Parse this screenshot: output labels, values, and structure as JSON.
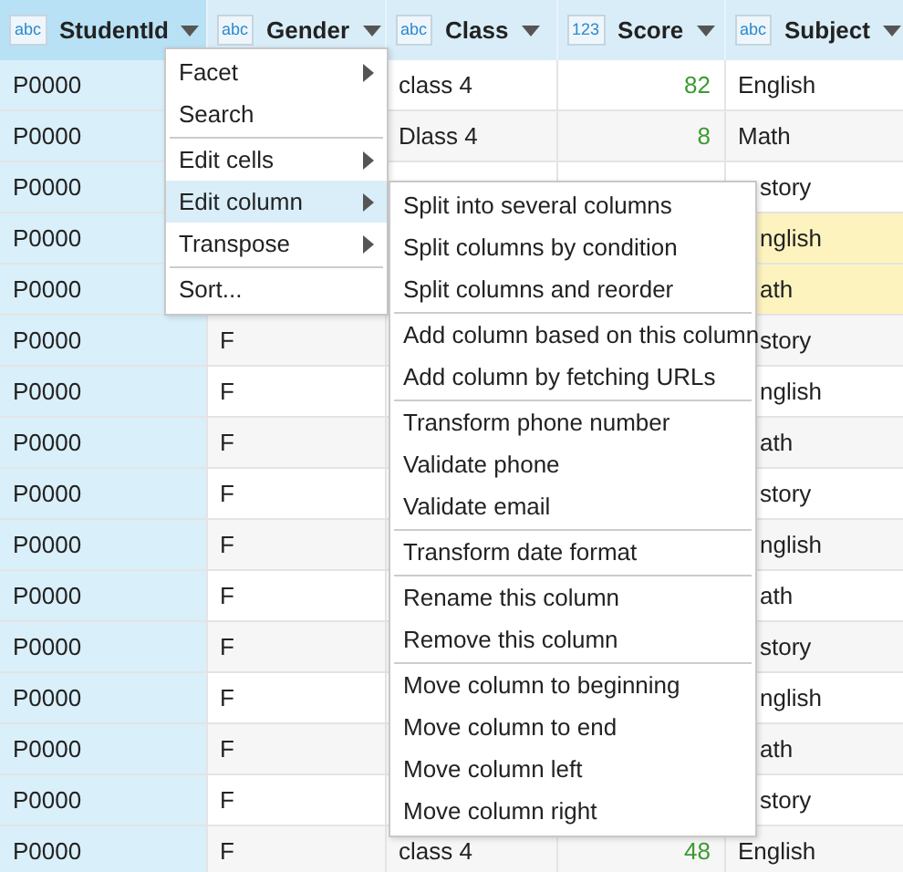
{
  "table": {
    "columns": [
      {
        "kind": "text",
        "type_label": "abc",
        "title": "StudentId",
        "selected": true
      },
      {
        "kind": "text",
        "type_label": "abc",
        "title": "Gender",
        "selected": false
      },
      {
        "kind": "text",
        "type_label": "abc",
        "title": "Class",
        "selected": false
      },
      {
        "kind": "number",
        "type_label": "123",
        "title": "Score",
        "selected": false
      },
      {
        "kind": "text",
        "type_label": "abc",
        "title": "Subject",
        "selected": false
      }
    ],
    "rows": [
      {
        "highlighted": false,
        "cells": [
          {
            "text": "P0000"
          },
          null,
          {
            "text": "class 4"
          },
          {
            "text": "82"
          },
          {
            "text": "English"
          }
        ]
      },
      {
        "highlighted": false,
        "cells": [
          {
            "text": "P0000"
          },
          null,
          {
            "text": "Dlass 4"
          },
          {
            "text": "8"
          },
          {
            "text": "Math"
          }
        ]
      },
      {
        "highlighted": false,
        "cells": [
          {
            "text": "P0000"
          },
          null,
          null,
          null,
          {
            "text": "story",
            "clipped": true
          }
        ]
      },
      {
        "highlighted": true,
        "cells": [
          {
            "text": "P0000"
          },
          null,
          null,
          null,
          {
            "text": "nglish",
            "clipped": true
          }
        ]
      },
      {
        "highlighted": true,
        "cells": [
          {
            "text": "P0000"
          },
          null,
          null,
          null,
          {
            "text": "ath",
            "clipped": true
          }
        ]
      },
      {
        "highlighted": false,
        "cells": [
          {
            "text": "P0000"
          },
          {
            "text": "F"
          },
          null,
          null,
          {
            "text": "story",
            "clipped": true
          }
        ]
      },
      {
        "highlighted": false,
        "cells": [
          {
            "text": "P0000"
          },
          {
            "text": "F"
          },
          null,
          null,
          {
            "text": "nglish",
            "clipped": true
          }
        ]
      },
      {
        "highlighted": false,
        "cells": [
          {
            "text": "P0000"
          },
          {
            "text": "F"
          },
          null,
          null,
          {
            "text": "ath",
            "clipped": true
          }
        ]
      },
      {
        "highlighted": false,
        "cells": [
          {
            "text": "P0000"
          },
          {
            "text": "F"
          },
          null,
          null,
          {
            "text": "story",
            "clipped": true
          }
        ]
      },
      {
        "highlighted": false,
        "cells": [
          {
            "text": "P0000"
          },
          {
            "text": "F"
          },
          null,
          null,
          {
            "text": "nglish",
            "clipped": true
          }
        ]
      },
      {
        "highlighted": false,
        "cells": [
          {
            "text": "P0000"
          },
          {
            "text": "F"
          },
          null,
          null,
          {
            "text": "ath",
            "clipped": true
          }
        ]
      },
      {
        "highlighted": false,
        "cells": [
          {
            "text": "P0000"
          },
          {
            "text": "F"
          },
          null,
          null,
          {
            "text": "story",
            "clipped": true
          }
        ]
      },
      {
        "highlighted": false,
        "cells": [
          {
            "text": "P0000"
          },
          {
            "text": "F"
          },
          null,
          null,
          {
            "text": "nglish",
            "clipped": true
          }
        ]
      },
      {
        "highlighted": false,
        "cells": [
          {
            "text": "P0000"
          },
          {
            "text": "F"
          },
          null,
          null,
          {
            "text": "ath",
            "clipped": true
          }
        ]
      },
      {
        "highlighted": false,
        "cells": [
          {
            "text": "P0000"
          },
          {
            "text": "F"
          },
          null,
          null,
          {
            "text": "story",
            "clipped": true
          }
        ]
      },
      {
        "highlighted": false,
        "cells": [
          {
            "text": "P0000"
          },
          {
            "text": "F"
          },
          {
            "text": "class 4"
          },
          {
            "text": "48"
          },
          {
            "text": "English"
          }
        ]
      }
    ]
  },
  "column_menu": {
    "items": [
      {
        "kind": "item",
        "label": "Facet",
        "submenu": true,
        "selected": false
      },
      {
        "kind": "item",
        "label": "Search",
        "submenu": false,
        "selected": false
      },
      {
        "kind": "separator"
      },
      {
        "kind": "item",
        "label": "Edit cells",
        "submenu": true,
        "selected": false
      },
      {
        "kind": "item",
        "label": "Edit column",
        "submenu": true,
        "selected": true
      },
      {
        "kind": "item",
        "label": "Transpose",
        "submenu": true,
        "selected": false
      },
      {
        "kind": "separator"
      },
      {
        "kind": "item",
        "label": "Sort...",
        "submenu": false,
        "selected": false
      }
    ]
  },
  "submenu": {
    "items": [
      {
        "kind": "item",
        "label": "Split into several columns"
      },
      {
        "kind": "item",
        "label": "Split columns by condition"
      },
      {
        "kind": "item",
        "label": "Split columns and reorder"
      },
      {
        "kind": "separator"
      },
      {
        "kind": "item",
        "label": "Add column based on this column"
      },
      {
        "kind": "item",
        "label": "Add column by fetching URLs"
      },
      {
        "kind": "separator"
      },
      {
        "kind": "item",
        "label": "Transform phone number"
      },
      {
        "kind": "item",
        "label": "Validate phone"
      },
      {
        "kind": "item",
        "label": "Validate email"
      },
      {
        "kind": "separator"
      },
      {
        "kind": "item",
        "label": "Transform date format"
      },
      {
        "kind": "separator"
      },
      {
        "kind": "item",
        "label": "Rename this column"
      },
      {
        "kind": "item",
        "label": "Remove this column"
      },
      {
        "kind": "separator"
      },
      {
        "kind": "item",
        "label": "Move column to beginning"
      },
      {
        "kind": "item",
        "label": "Move column to end"
      },
      {
        "kind": "item",
        "label": "Move column left"
      },
      {
        "kind": "item",
        "label": "Move column right"
      }
    ]
  }
}
